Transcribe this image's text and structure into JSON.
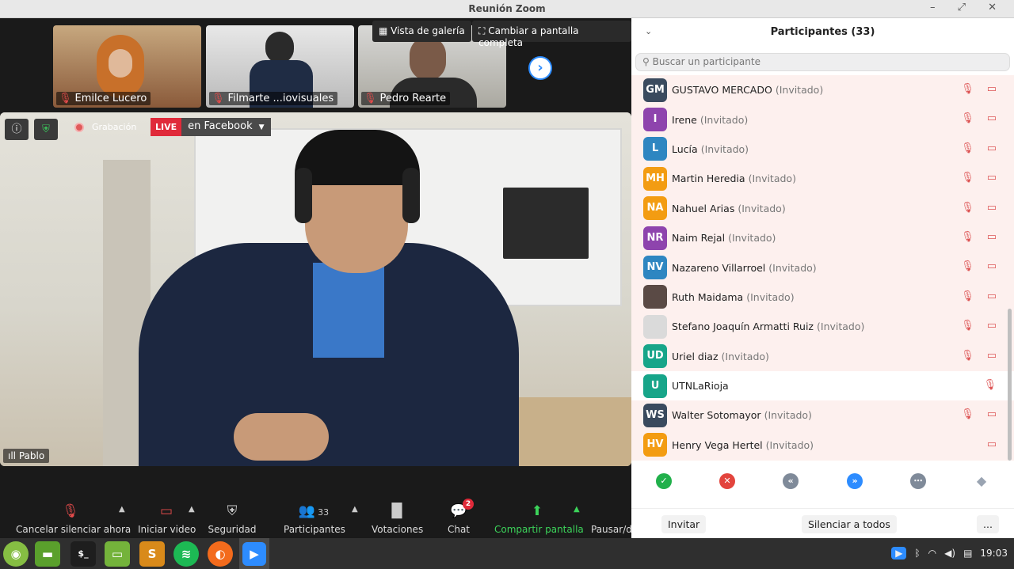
{
  "window": {
    "title": "Reunión Zoom",
    "controls": "– ⤢ ✕"
  },
  "thumbnails": [
    {
      "name": "Emilce Lucero"
    },
    {
      "name": "Filmarte ...iovisuales"
    },
    {
      "name": "Pedro Rearte"
    }
  ],
  "top_buttons": {
    "gallery": "Vista de galería",
    "fullscreen": "Cambiar a pantalla completa",
    "next": "›"
  },
  "overlay": {
    "recording": "Grabación",
    "live": "LIVE",
    "live_target": "en Facebook",
    "speaker": "Pablo"
  },
  "toolbar": {
    "mute": "Cancelar silenciar ahora",
    "video": "Iniciar video",
    "security": "Seguridad",
    "participants": "Participantes",
    "participants_count": "33",
    "polls": "Votaciones",
    "chat": "Chat",
    "chat_badge": "2",
    "share": "Compartir pantalla",
    "pause": "Pausar/d"
  },
  "panel": {
    "title": "Participantes (33)",
    "search_placeholder": "Buscar un participante",
    "participants": [
      {
        "initials": "GM",
        "name": "GUSTAVO MERCADO",
        "role": "(Invitado)",
        "color": "#3a4a5e",
        "status": "🎙 ▭"
      },
      {
        "initials": "I",
        "name": "Irene",
        "role": "(Invitado)",
        "color": "#8e44ad",
        "status": "🎙 ▭"
      },
      {
        "initials": "L",
        "name": "Lucía",
        "role": "(Invitado)",
        "color": "#2e86c1",
        "status": "🎙 ▭"
      },
      {
        "initials": "MH",
        "name": "Martin Heredia",
        "role": "(Invitado)",
        "color": "#f39c12",
        "status": "🎙 ▭"
      },
      {
        "initials": "NA",
        "name": "Nahuel Arias",
        "role": "(Invitado)",
        "color": "#f39c12",
        "status": "🎙 ▭"
      },
      {
        "initials": "NR",
        "name": "Naim Rejal",
        "role": "(Invitado)",
        "color": "#8e44ad",
        "status": "🎙 ▭"
      },
      {
        "initials": "NV",
        "name": "Nazareno Villarroel",
        "role": "(Invitado)",
        "color": "#2e86c1",
        "status": "🎙 ▭"
      },
      {
        "initials": "",
        "name": "Ruth Maidama",
        "role": "(Invitado)",
        "color": "#5a4a45",
        "status": "🎙 ▭"
      },
      {
        "initials": "",
        "name": "Stefano Joaquín Armatti Ruiz",
        "role": "(Invitado)",
        "color": "#dadada",
        "status": "🎙 ▭"
      },
      {
        "initials": "UD",
        "name": "Uriel diaz",
        "role": "(Invitado)",
        "color": "#17a589",
        "status": "🎙 ▭"
      },
      {
        "initials": "U",
        "name": "UTNLaRioja",
        "role": "",
        "color": "#17a589",
        "status": "🎙"
      },
      {
        "initials": "WS",
        "name": "Walter Sotomayor",
        "role": "(Invitado)",
        "color": "#3a4a5e",
        "status": "🎙 ▭"
      },
      {
        "initials": "HV",
        "name": "Henry Vega Hertel",
        "role": "(Invitado)",
        "color": "#f39c12",
        "status": "▭"
      }
    ],
    "invite": "Invitar",
    "mute_all": "Silenciar a todos",
    "more": "..."
  },
  "taskbar": {
    "clock": "19:03"
  }
}
